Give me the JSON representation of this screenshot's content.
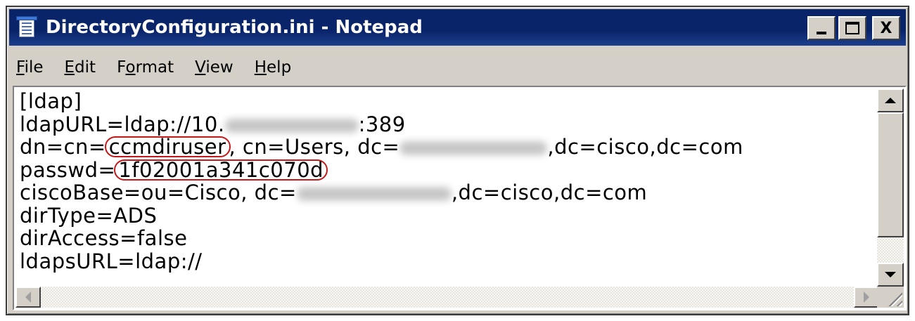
{
  "window": {
    "title": "DirectoryConfiguration.ini - Notepad",
    "buttons": {
      "minimize": "_",
      "maximize": "□",
      "close": "X"
    }
  },
  "menu": [
    {
      "label": "File",
      "accel": "F",
      "rest": "ile"
    },
    {
      "label": "Edit",
      "accel": "E",
      "rest": "dit"
    },
    {
      "label": "Format",
      "pre": "F",
      "accel": "o",
      "rest": "rmat"
    },
    {
      "label": "View",
      "accel": "V",
      "rest": "iew"
    },
    {
      "label": "Help",
      "accel": "H",
      "rest": "elp"
    }
  ],
  "document": {
    "line1": "[ldap]",
    "line2_a": "ldapURL=ldap://10.",
    "line2_b": ":389",
    "line3_a": "dn=cn=",
    "line3_user": "ccmdiruser",
    "line3_b": ", cn=Users, dc=",
    "line3_c": ",dc=cisco,dc=com",
    "line4_a": "passwd=",
    "line4_pw": "1f02001a341c070d",
    "line5_a": "ciscoBase=ou=Cisco, dc=",
    "line5_b": ",dc=cisco,dc=com",
    "line6": "dirType=ADS",
    "line7": "dirAccess=false",
    "line8": "ldapsURL=ldap://"
  },
  "colors": {
    "titlebar": "#0a246a",
    "highlight_circle": "#c21a1a",
    "chrome": "#d4d0c8"
  },
  "icons": {
    "app": "notepad-icon",
    "scroll_up": "arrow-up-icon",
    "scroll_down": "arrow-down-icon",
    "scroll_left": "arrow-left-icon",
    "scroll_right": "arrow-right-icon",
    "grip": "resize-grip-icon"
  }
}
